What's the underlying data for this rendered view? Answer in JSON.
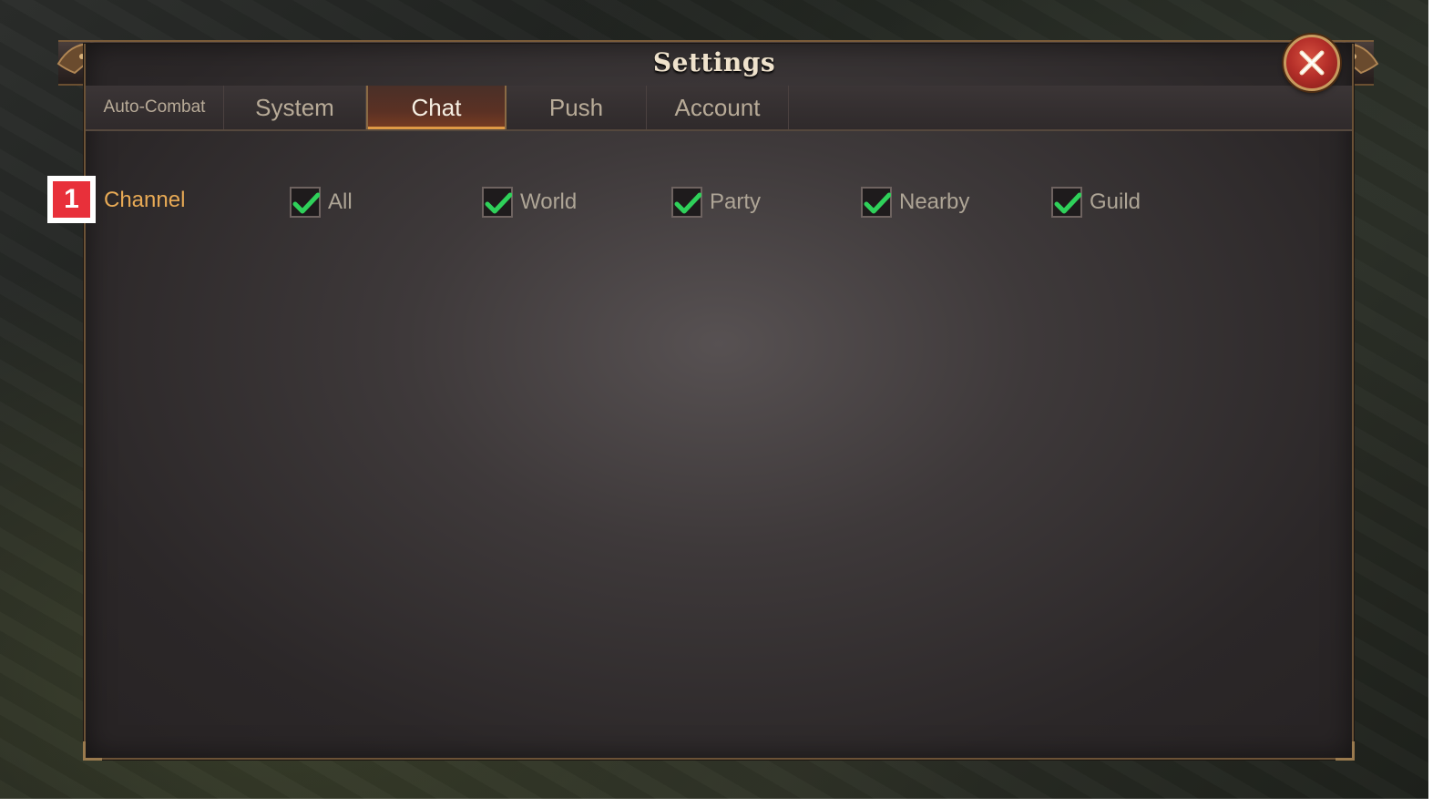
{
  "dialog": {
    "title": "Settings",
    "close_icon": "close-x-icon"
  },
  "tabs": [
    {
      "label": "Auto-Combat",
      "active": false
    },
    {
      "label": "System",
      "active": false
    },
    {
      "label": "Chat",
      "active": true
    },
    {
      "label": "Push",
      "active": false
    },
    {
      "label": "Account",
      "active": false
    }
  ],
  "marker": {
    "label": "1"
  },
  "channel": {
    "label": "Channel",
    "options": [
      {
        "label": "All",
        "checked": true
      },
      {
        "label": "World",
        "checked": true
      },
      {
        "label": "Party",
        "checked": true
      },
      {
        "label": "Nearby",
        "checked": true
      },
      {
        "label": "Guild",
        "checked": true
      }
    ]
  },
  "colors": {
    "accent_orange": "#e8aa55",
    "check_green": "#2fd15a",
    "close_red": "#b6302a",
    "marker_red": "#e8303a"
  }
}
